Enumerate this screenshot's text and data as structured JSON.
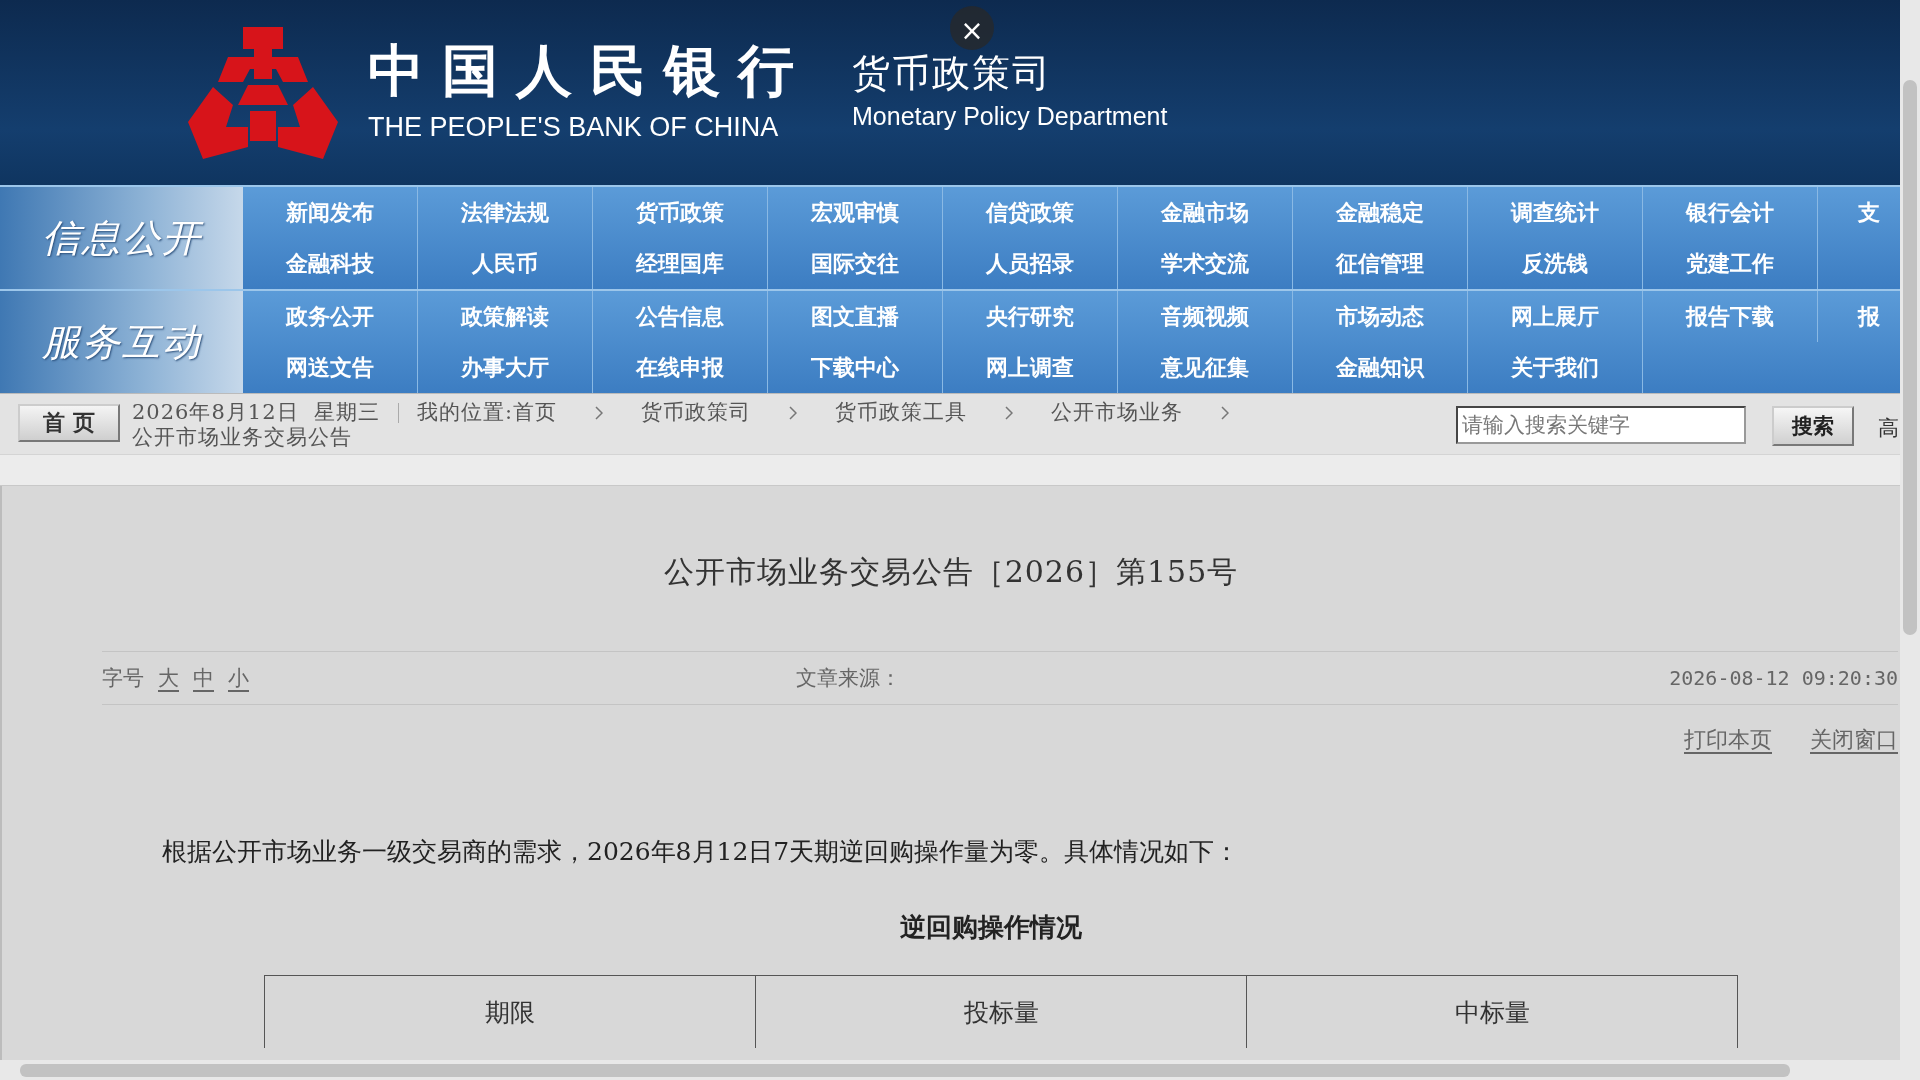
{
  "header": {
    "bank_name_cn": "中国人民银行",
    "bank_name_en": "THE PEOPLE'S BANK OF CHINA",
    "dept_cn": "货币政策司",
    "dept_en": "Monetary Policy Department",
    "close_button": "×"
  },
  "nav_groups": [
    {
      "label": "信息公开",
      "rows": [
        [
          "新闻发布",
          "法律法规",
          "货币政策",
          "宏观审慎",
          "信贷政策",
          "金融市场",
          "金融稳定",
          "调查统计",
          "银行会计",
          "支"
        ],
        [
          "金融科技",
          "人民币",
          "经理国库",
          "国际交往",
          "人员招录",
          "学术交流",
          "征信管理",
          "反洗钱",
          "党建工作"
        ]
      ]
    },
    {
      "label": "服务互动",
      "rows": [
        [
          "政务公开",
          "政策解读",
          "公告信息",
          "图文直播",
          "央行研究",
          "音频视频",
          "市场动态",
          "网上展厅",
          "报告下载",
          "报"
        ],
        [
          "网送文告",
          "办事大厅",
          "在线申报",
          "下载中心",
          "网上调查",
          "意见征集",
          "金融知识",
          "关于我们"
        ]
      ]
    }
  ],
  "toolbar": {
    "home_button": "首 页",
    "date": "2026年8月12日  星期三",
    "breadcrumb": [
      "我的位置:首页",
      "货币政策司",
      "货币政策工具",
      "公开市场业务",
      "公开市场业务交易公告"
    ],
    "search": {
      "placeholder": "请输入搜索关键字"
    },
    "search_button": "搜索",
    "cut_link": "高"
  },
  "article": {
    "title": "公开市场业务交易公告［2026］第155号",
    "font_size_label": "字号",
    "font_sizes": [
      "大",
      "中",
      "小"
    ],
    "source_label": "文章来源：",
    "time": "2026-08-12 09:20:30",
    "actions": [
      "打印本页",
      "关闭窗口"
    ],
    "paragraph": "根据公开市场业务一级交易商的需求，2026年8月12日7天期逆回购操作量为零。具体情况如下：",
    "table_title": "逆回购操作情况",
    "table_columns": [
      "期限",
      "投标量",
      "中标量"
    ]
  }
}
